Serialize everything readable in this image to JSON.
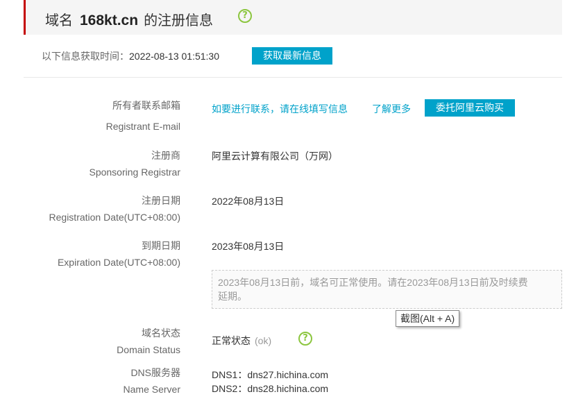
{
  "header": {
    "prefix": "域名",
    "domain": "168kt.cn",
    "suffix": "的注册信息",
    "help_icon": "question-circle-icon"
  },
  "fetch": {
    "label": "以下信息获取时间：",
    "time": "2022-08-13 01:51:30",
    "button": "获取最新信息"
  },
  "registrant": {
    "label_cn": "所有者联系邮箱",
    "label_en": "Registrant E-mail",
    "contact_link": "如要进行联系，请在线填写信息",
    "learn_more_link": "了解更多",
    "buy_button": "委托阿里云购买"
  },
  "registrar": {
    "label_cn": "注册商",
    "label_en": "Sponsoring Registrar",
    "value": "阿里云计算有限公司（万网）"
  },
  "registration_date": {
    "label_cn": "注册日期",
    "label_en": "Registration Date(UTC+08:00)",
    "value": "2022年08月13日"
  },
  "expiration_date": {
    "label_cn": "到期日期",
    "label_en": "Expiration Date(UTC+08:00)",
    "value": "2023年08月13日",
    "notice_line1": "2023年08月13日前，域名可正常使用。请在2023年08月13日前及时续费",
    "notice_line2": "延期。"
  },
  "tooltip": {
    "text": "截图(Alt + A)"
  },
  "domain_status": {
    "label_cn": "域名状态",
    "label_en": "Domain Status",
    "value": "正常状态",
    "code": "(ok)",
    "help_icon": "question-circle-icon"
  },
  "dns": {
    "label_cn": "DNS服务器",
    "label_en": "Name Server",
    "servers": [
      "DNS1：dns27.hichina.com",
      "DNS2：dns28.hichina.com"
    ]
  },
  "colors": {
    "accent_blue": "#00a2ca",
    "header_bar_red": "#c40000",
    "help_icon_green": "#8cc63f"
  }
}
